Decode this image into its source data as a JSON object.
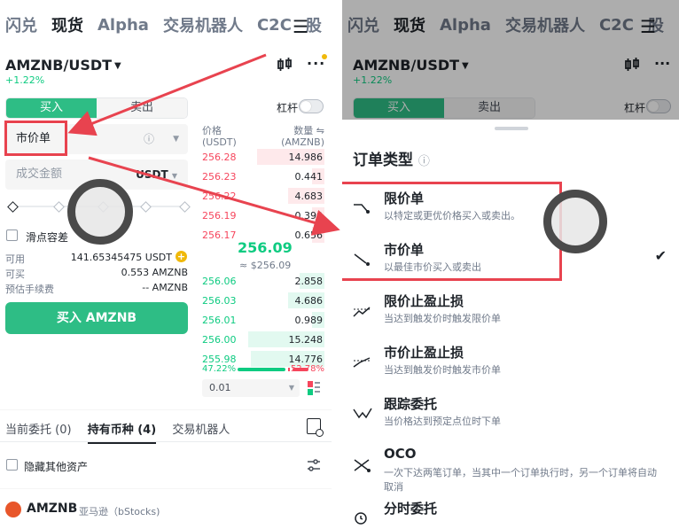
{
  "top_tabs": [
    "闪兑",
    "现货",
    "Alpha",
    "交易机器人",
    "C2C",
    "股"
  ],
  "active_tab": "现货",
  "menu_icon": "menu-icon",
  "pair": "AMZNB/USDT",
  "change": "+1.22%",
  "order_side": {
    "buy": "买入",
    "sell": "卖出"
  },
  "leverage_label": "杠杆",
  "order_type_field": "市价单",
  "amount": {
    "placeholder": "成交金额",
    "unit": "USDT"
  },
  "slippage_label": "滑点容差",
  "available": {
    "label": "可用",
    "value": "141.65345475 USDT"
  },
  "can_buy": {
    "label": "可买",
    "value": "0.553 AMZNB"
  },
  "fee": {
    "label": "预估手续费",
    "value": "-- AMZNB"
  },
  "buy_button": "买入 AMZNB",
  "orderbook": {
    "header_price": "价格",
    "header_price_unit": "(USDT)",
    "header_qty": "数量",
    "header_qty_unit": "(AMZNB)",
    "asks": [
      {
        "price": "256.28",
        "qty": "14.986",
        "depth": 0.55
      },
      {
        "price": "256.23",
        "qty": "0.441",
        "depth": 0.1
      },
      {
        "price": "256.22",
        "qty": "4.683",
        "depth": 0.3
      },
      {
        "price": "256.19",
        "qty": "0.390",
        "depth": 0.1
      },
      {
        "price": "256.17",
        "qty": "0.656",
        "depth": 0.1
      }
    ],
    "last_price": "256.09",
    "last_price_usd": "≈ $256.09",
    "bids": [
      {
        "price": "256.06",
        "qty": "2.858",
        "depth": 0.2
      },
      {
        "price": "256.03",
        "qty": "4.686",
        "depth": 0.3
      },
      {
        "price": "256.01",
        "qty": "0.989",
        "depth": 0.1
      },
      {
        "price": "256.00",
        "qty": "15.248",
        "depth": 0.62
      },
      {
        "price": "255.98",
        "qty": "14.776",
        "depth": 0.6
      }
    ],
    "buy_ratio": "47.22%",
    "sell_ratio": "52.78%",
    "precision": "0.01"
  },
  "bottom_tabs": [
    "当前委托 (0)",
    "持有币种 (4)",
    "交易机器人"
  ],
  "active_bottom_tab": "持有币种 (4)",
  "hide_assets_label": "隐藏其他资产",
  "holding": {
    "symbol": "AMZNB",
    "name": "亚马逊（bStocks)"
  },
  "sheet": {
    "title": "订单类型",
    "items": [
      {
        "title": "限价单",
        "desc": "以特定或更优价格买入或卖出。",
        "icon": "limit-order-icon"
      },
      {
        "title": "市价单",
        "desc": "以最佳市价买入或卖出",
        "icon": "market-order-icon",
        "selected": true
      },
      {
        "title": "限价止盈止损",
        "desc": "当达到触发价时触发限价单",
        "icon": "stop-limit-icon"
      },
      {
        "title": "市价止盈止损",
        "desc": "当达到触发价时触发市价单",
        "icon": "stop-market-icon"
      },
      {
        "title": "跟踪委托",
        "desc": "当价格达到预定点位时下单",
        "icon": "trailing-stop-icon"
      },
      {
        "title": "OCO",
        "desc": "一次下达两笔订单，当其中一个订单执行时，另一个订单将自动取消",
        "icon": "oco-icon"
      },
      {
        "title": "分时委托",
        "desc": "",
        "icon": "twap-icon"
      }
    ]
  },
  "colors": {
    "green": "#0ecb81",
    "red": "#f6465d",
    "accent": "#f0b90b",
    "highlight": "#e8434f"
  }
}
